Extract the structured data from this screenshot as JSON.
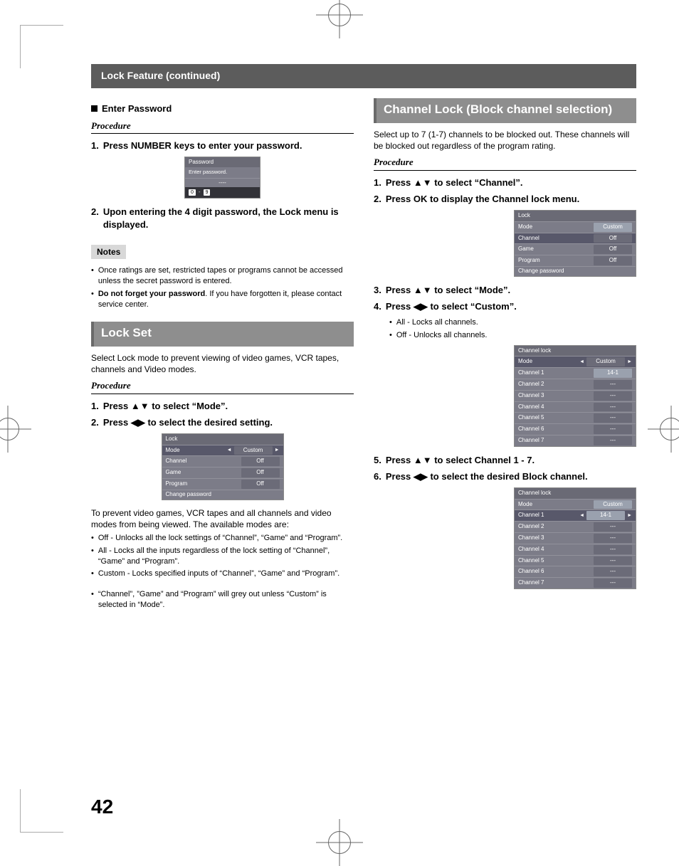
{
  "page_number": "42",
  "header": "Lock Feature (continued)",
  "left": {
    "enter_password_heading": "Enter Password",
    "procedure_label": "Procedure",
    "step1": "Press NUMBER keys to enter your password.",
    "step2": "Upon entering the 4 digit password, the Lock menu is displayed.",
    "osd_password": {
      "title": "Password",
      "hint": "Enter password.",
      "value": "----",
      "key0": "0",
      "key9": "9",
      "dash": "-"
    },
    "notes_label": "Notes",
    "note1": "Once ratings are set, restricted tapes or programs cannot be accessed unless the secret password is entered.",
    "note2_bold": "Do not forget your password",
    "note2_rest": ". If you have forgotten it, please contact service center.",
    "lockset_title": "Lock Set",
    "lockset_intro": "Select Lock mode to prevent viewing of video games, VCR tapes, channels and Video modes.",
    "ls_step1": "Press ▲▼ to select “Mode”.",
    "ls_step2": "Press ◀▶ to select the desired setting.",
    "osd_lock": {
      "title": "Lock",
      "rows": [
        {
          "label": "Mode",
          "val": "Custom",
          "active": true,
          "arrows": true
        },
        {
          "label": "Channel",
          "val": "Off"
        },
        {
          "label": "Game",
          "val": "Off"
        },
        {
          "label": "Program",
          "val": "Off"
        },
        {
          "label": "Change password",
          "val": ""
        }
      ]
    },
    "prevent_text": "To prevent video games, VCR tapes and all channels and video modes from being viewed. The available modes are:",
    "mode_off": "Off - Unlocks all the lock settings of “Channel”, “Game” and “Program”.",
    "mode_all": "All - Locks all the inputs regardless of the lock setting of “Channel”, “Game” and “Program”.",
    "mode_custom": "Custom - Locks specified inputs of “Channel”, “Game” and “Program”.",
    "grey_note": "“Channel”, ”Game” and “Program” will grey out unless “Custom” is selected in “Mode”."
  },
  "right": {
    "chlock_title": "Channel Lock (Block channel selection)",
    "chlock_intro": "Select up to 7 (1-7) channels to be blocked out. These channels will be blocked out regardless of the program rating.",
    "procedure_label": "Procedure",
    "step1": "Press ▲▼ to select “Channel”.",
    "step2": "Press OK to display the Channel lock menu.",
    "osd_lock2": {
      "title": "Lock",
      "rows": [
        {
          "label": "Mode",
          "val": "Custom",
          "sel": true
        },
        {
          "label": "Channel",
          "val": "Off",
          "active": true
        },
        {
          "label": "Game",
          "val": "Off"
        },
        {
          "label": "Program",
          "val": "Off"
        },
        {
          "label": "Change password",
          "val": ""
        }
      ]
    },
    "step3": "Press ▲▼ to select “Mode”.",
    "step4": "Press ◀▶ to select “Custom”.",
    "sub_all": "All - Locks all channels.",
    "sub_off": "Off - Unlocks all channels.",
    "osd_chlock1": {
      "title": "Channel lock",
      "rows": [
        {
          "label": "Mode",
          "val": "Custom",
          "active": true,
          "arrows": true
        },
        {
          "label": "Channel 1",
          "val": "14-1",
          "sel": true
        },
        {
          "label": "Channel 2",
          "val": "---"
        },
        {
          "label": "Channel 3",
          "val": "---"
        },
        {
          "label": "Channel 4",
          "val": "---"
        },
        {
          "label": "Channel 5",
          "val": "---"
        },
        {
          "label": "Channel 6",
          "val": "---"
        },
        {
          "label": "Channel 7",
          "val": "---"
        }
      ]
    },
    "step5": "Press ▲▼ to select Channel 1 - 7.",
    "step6": "Press ◀▶ to select the desired Block channel.",
    "osd_chlock2": {
      "title": "Channel lock",
      "rows": [
        {
          "label": "Mode",
          "val": "Custom",
          "sel": true
        },
        {
          "label": "Channel 1",
          "val": "14-1",
          "active": true,
          "arrows": true,
          "sel": true
        },
        {
          "label": "Channel 2",
          "val": "---"
        },
        {
          "label": "Channel 3",
          "val": "---"
        },
        {
          "label": "Channel 4",
          "val": "---"
        },
        {
          "label": "Channel 5",
          "val": "---"
        },
        {
          "label": "Channel 6",
          "val": "---"
        },
        {
          "label": "Channel 7",
          "val": "---"
        }
      ]
    }
  }
}
